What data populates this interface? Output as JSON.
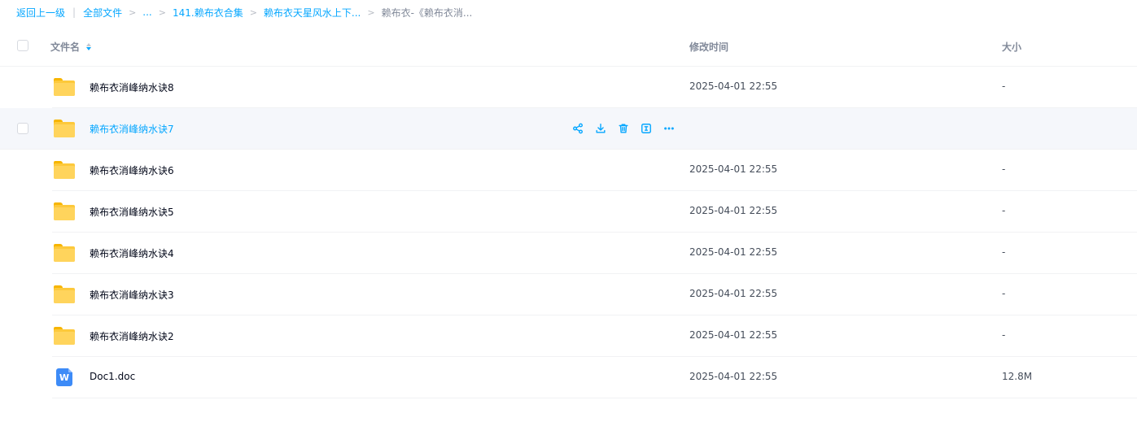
{
  "breadcrumb": {
    "back": "返回上一级",
    "divider": "|",
    "all_files": "全部文件",
    "sep": ">",
    "ellipsis": "...",
    "crumb1": "141.赖布衣合集",
    "crumb2": "赖布衣天星风水上下...",
    "current": "赖布衣-《赖布衣消..."
  },
  "header": {
    "name": "文件名",
    "modified": "修改时间",
    "size": "大小"
  },
  "files": [
    {
      "name": "赖布衣消峰纳水诀8",
      "time": "2025-04-01 22:55",
      "size": "-",
      "type": "folder"
    },
    {
      "name": "赖布衣消峰纳水诀7",
      "time": "",
      "size": "",
      "type": "folder",
      "hovered": true
    },
    {
      "name": "赖布衣消峰纳水诀6",
      "time": "2025-04-01 22:55",
      "size": "-",
      "type": "folder"
    },
    {
      "name": "赖布衣消峰纳水诀5",
      "time": "2025-04-01 22:55",
      "size": "-",
      "type": "folder"
    },
    {
      "name": "赖布衣消峰纳水诀4",
      "time": "2025-04-01 22:55",
      "size": "-",
      "type": "folder"
    },
    {
      "name": "赖布衣消峰纳水诀3",
      "time": "2025-04-01 22:55",
      "size": "-",
      "type": "folder"
    },
    {
      "name": "赖布衣消峰纳水诀2",
      "time": "2025-04-01 22:55",
      "size": "-",
      "type": "folder"
    },
    {
      "name": "Doc1.doc",
      "time": "2025-04-01 22:55",
      "size": "12.8M",
      "type": "word-doc"
    }
  ],
  "doc_icon_letter": "W",
  "hover_actions": [
    "share-icon",
    "download-icon",
    "delete-icon",
    "rename-icon",
    "more-icon"
  ],
  "colors": {
    "accent": "#06a7ff",
    "folder": "#ffd45c",
    "doc": "#3d8bf7",
    "hover_row": "#f5f7fb"
  }
}
